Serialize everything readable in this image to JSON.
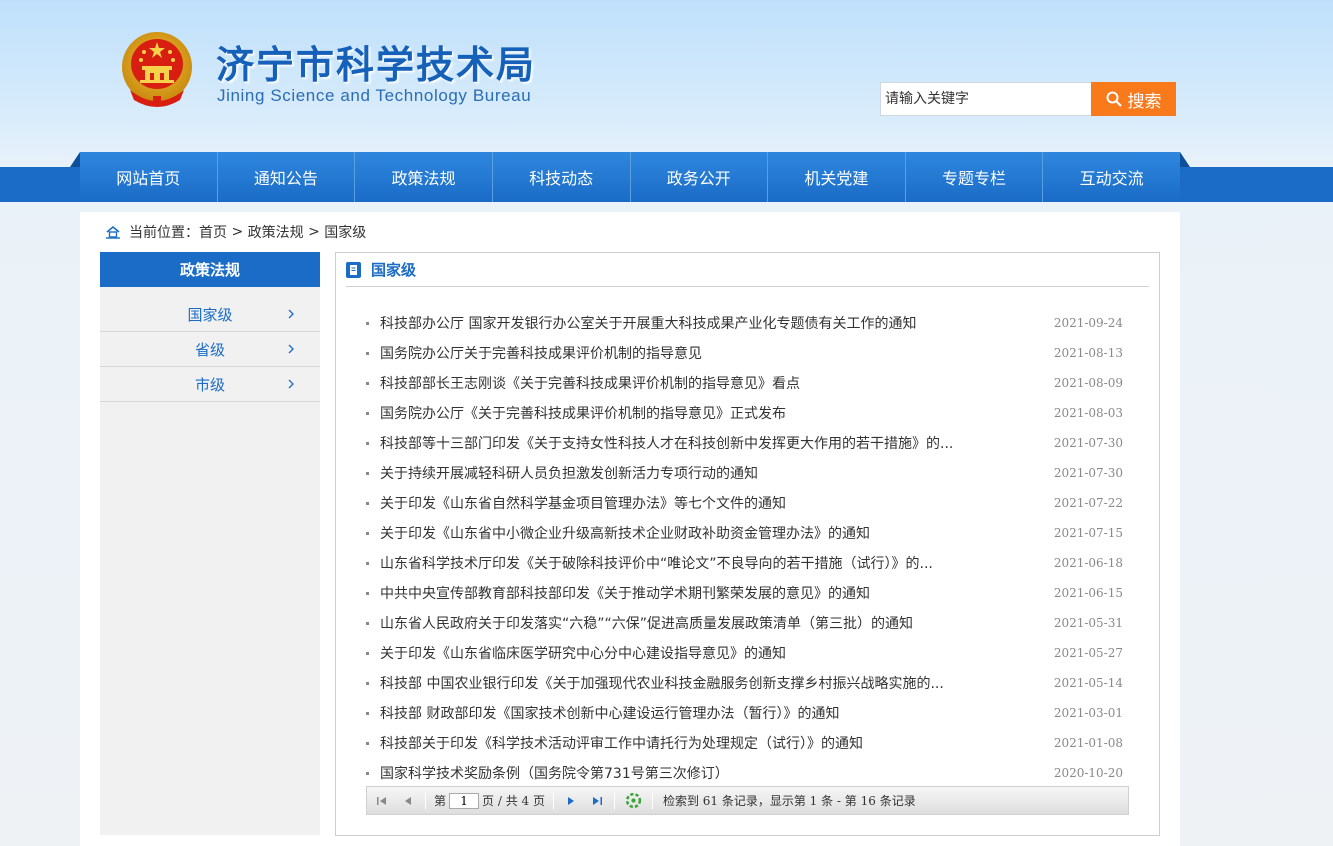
{
  "header": {
    "title": "济宁市科学技术局",
    "subtitle": "Jining Science and Technology Bureau",
    "search": {
      "placeholder": "请输入关键字",
      "button": "搜索"
    }
  },
  "nav": [
    "网站首页",
    "通知公告",
    "政策法规",
    "科技动态",
    "政务公开",
    "机关党建",
    "专题专栏",
    "互动交流"
  ],
  "breadcrumb": {
    "prefix": "当前位置：",
    "items": [
      "首页",
      "政策法规",
      "国家级"
    ],
    "separator": " > "
  },
  "sidebar": {
    "title": "政策法规",
    "items": [
      "国家级",
      "省级",
      "市级"
    ]
  },
  "panel": {
    "title": "国家级"
  },
  "articles": [
    {
      "title": "科技部办公厅 国家开发银行办公室关于开展重大科技成果产业化专题债有关工作的通知",
      "date": "2021-09-24"
    },
    {
      "title": "国务院办公厅关于完善科技成果评价机制的指导意见",
      "date": "2021-08-13"
    },
    {
      "title": "科技部部长王志刚谈《关于完善科技成果评价机制的指导意见》看点",
      "date": "2021-08-09"
    },
    {
      "title": "国务院办公厅《关于完善科技成果评价机制的指导意见》正式发布",
      "date": "2021-08-03"
    },
    {
      "title": "科技部等十三部门印发《关于支持女性科技人才在科技创新中发挥更大作用的若干措施》的...",
      "date": "2021-07-30"
    },
    {
      "title": "关于持续开展减轻科研人员负担激发创新活力专项行动的通知",
      "date": "2021-07-30"
    },
    {
      "title": "关于印发《山东省自然科学基金项目管理办法》等七个文件的通知",
      "date": "2021-07-22"
    },
    {
      "title": "关于印发《山东省中小微企业升级高新技术企业财政补助资金管理办法》的通知",
      "date": "2021-07-15"
    },
    {
      "title": "山东省科学技术厅印发《关于破除科技评价中“唯论文”不良导向的若干措施（试行）》的...",
      "date": "2021-06-18"
    },
    {
      "title": "中共中央宣传部教育部科技部印发《关于推动学术期刊繁荣发展的意见》的通知",
      "date": "2021-06-15"
    },
    {
      "title": "山东省人民政府关于印发落实“六稳”“六保”促进高质量发展政策清单（第三批）的通知",
      "date": "2021-05-31"
    },
    {
      "title": "关于印发《山东省临床医学研究中心分中心建设指导意见》的通知",
      "date": "2021-05-27"
    },
    {
      "title": "科技部 中国农业银行印发《关于加强现代农业科技金融服务创新支撑乡村振兴战略实施的...",
      "date": "2021-05-14"
    },
    {
      "title": "科技部 财政部印发《国家技术创新中心建设运行管理办法（暂行）》的通知",
      "date": "2021-03-01"
    },
    {
      "title": "科技部关于印发《科学技术活动评审工作中请托行为处理规定（试行）》的通知",
      "date": "2021-01-08"
    },
    {
      "title": "国家科学技术奖励条例（国务院令第731号第三次修订）",
      "date": "2020-10-20"
    }
  ],
  "pager": {
    "page_prefix": "第",
    "page_value": "1",
    "page_suffix": "页 / 共 4 页",
    "summary": "检索到 61 条记录，显示第 1 条 - 第 16 条记录"
  },
  "colors": {
    "primary": "#1a6cc6",
    "accent": "#f97a1b"
  },
  "icons": {
    "emblem": "national-emblem-icon",
    "search": "search-icon",
    "home": "home-icon",
    "doc": "document-icon",
    "chevron": "chevron-right-icon"
  }
}
